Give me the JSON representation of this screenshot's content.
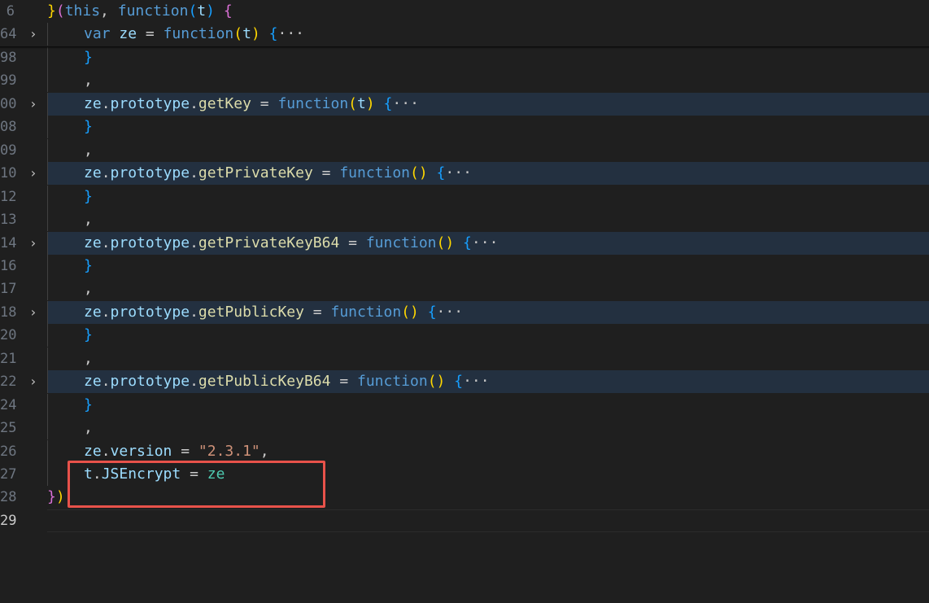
{
  "editor": {
    "theme_colors": {
      "background": "#1f1f1f",
      "collapsed_line_bg": "#233040",
      "keyword": "#569cd6",
      "variable": "#9cdcfe",
      "function_name": "#dcdcaa",
      "string": "#ce9178",
      "class_name": "#4ec9b0",
      "brace_level1": "#ffd700",
      "paren_level2": "#da70d6",
      "brace_level2": "#179fff",
      "highlight_box": "#e8524a"
    },
    "fold_icon": "chevron-right-icon",
    "lines": [
      {
        "number": "6",
        "fold": "",
        "collapsed": false,
        "indent": 0,
        "tokens": [
          {
            "t": "}",
            "c": "brace-gold"
          },
          {
            "t": "(",
            "c": "paren-pink"
          },
          {
            "t": "this",
            "c": "keyword"
          },
          {
            "t": ", ",
            "c": "punc"
          },
          {
            "t": "function",
            "c": "keyword"
          },
          {
            "t": "(",
            "c": "brace-blue"
          },
          {
            "t": "t",
            "c": "var"
          },
          {
            "t": ") ",
            "c": "brace-blue"
          },
          {
            "t": "{",
            "c": "paren-pink"
          }
        ]
      },
      {
        "number": "64",
        "fold": "›",
        "collapsed": false,
        "indent": 1,
        "tokens": [
          {
            "t": "var ",
            "c": "keyword"
          },
          {
            "t": "ze",
            "c": "var"
          },
          {
            "t": " = ",
            "c": "punc"
          },
          {
            "t": "function",
            "c": "keyword"
          },
          {
            "t": "(",
            "c": "brace-gold"
          },
          {
            "t": "t",
            "c": "var"
          },
          {
            "t": ") ",
            "c": "brace-gold"
          },
          {
            "t": "{",
            "c": "brace-blue"
          },
          {
            "t": "···",
            "c": "ellipsis"
          }
        ]
      },
      {
        "number": "98",
        "fold": "",
        "collapsed": false,
        "indent": 1,
        "tokens": [
          {
            "t": "}",
            "c": "brace-blue"
          }
        ]
      },
      {
        "number": "99",
        "fold": "",
        "collapsed": false,
        "indent": 1,
        "tokens": [
          {
            "t": ",",
            "c": "punc"
          }
        ]
      },
      {
        "number": "00",
        "fold": "›",
        "collapsed": true,
        "indent": 1,
        "tokens": [
          {
            "t": "ze",
            "c": "var"
          },
          {
            "t": ".",
            "c": "punc"
          },
          {
            "t": "prototype",
            "c": "var"
          },
          {
            "t": ".",
            "c": "punc"
          },
          {
            "t": "getKey",
            "c": "func"
          },
          {
            "t": " = ",
            "c": "punc"
          },
          {
            "t": "function",
            "c": "keyword"
          },
          {
            "t": "(",
            "c": "brace-gold"
          },
          {
            "t": "t",
            "c": "var"
          },
          {
            "t": ") ",
            "c": "brace-gold"
          },
          {
            "t": "{",
            "c": "brace-blue"
          },
          {
            "t": "···",
            "c": "ellipsis"
          }
        ]
      },
      {
        "number": "08",
        "fold": "",
        "collapsed": false,
        "indent": 1,
        "tokens": [
          {
            "t": "}",
            "c": "brace-blue"
          }
        ]
      },
      {
        "number": "09",
        "fold": "",
        "collapsed": false,
        "indent": 1,
        "tokens": [
          {
            "t": ",",
            "c": "punc"
          }
        ]
      },
      {
        "number": "10",
        "fold": "›",
        "collapsed": true,
        "indent": 1,
        "tokens": [
          {
            "t": "ze",
            "c": "var"
          },
          {
            "t": ".",
            "c": "punc"
          },
          {
            "t": "prototype",
            "c": "var"
          },
          {
            "t": ".",
            "c": "punc"
          },
          {
            "t": "getPrivateKey",
            "c": "func"
          },
          {
            "t": " = ",
            "c": "punc"
          },
          {
            "t": "function",
            "c": "keyword"
          },
          {
            "t": "() ",
            "c": "brace-gold"
          },
          {
            "t": "{",
            "c": "brace-blue"
          },
          {
            "t": "···",
            "c": "ellipsis"
          }
        ]
      },
      {
        "number": "12",
        "fold": "",
        "collapsed": false,
        "indent": 1,
        "tokens": [
          {
            "t": "}",
            "c": "brace-blue"
          }
        ]
      },
      {
        "number": "13",
        "fold": "",
        "collapsed": false,
        "indent": 1,
        "tokens": [
          {
            "t": ",",
            "c": "punc"
          }
        ]
      },
      {
        "number": "14",
        "fold": "›",
        "collapsed": true,
        "indent": 1,
        "tokens": [
          {
            "t": "ze",
            "c": "var"
          },
          {
            "t": ".",
            "c": "punc"
          },
          {
            "t": "prototype",
            "c": "var"
          },
          {
            "t": ".",
            "c": "punc"
          },
          {
            "t": "getPrivateKeyB64",
            "c": "func"
          },
          {
            "t": " = ",
            "c": "punc"
          },
          {
            "t": "function",
            "c": "keyword"
          },
          {
            "t": "() ",
            "c": "brace-gold"
          },
          {
            "t": "{",
            "c": "brace-blue"
          },
          {
            "t": "···",
            "c": "ellipsis"
          }
        ]
      },
      {
        "number": "16",
        "fold": "",
        "collapsed": false,
        "indent": 1,
        "tokens": [
          {
            "t": "}",
            "c": "brace-blue"
          }
        ]
      },
      {
        "number": "17",
        "fold": "",
        "collapsed": false,
        "indent": 1,
        "tokens": [
          {
            "t": ",",
            "c": "punc"
          }
        ]
      },
      {
        "number": "18",
        "fold": "›",
        "collapsed": true,
        "indent": 1,
        "tokens": [
          {
            "t": "ze",
            "c": "var"
          },
          {
            "t": ".",
            "c": "punc"
          },
          {
            "t": "prototype",
            "c": "var"
          },
          {
            "t": ".",
            "c": "punc"
          },
          {
            "t": "getPublicKey",
            "c": "func"
          },
          {
            "t": " = ",
            "c": "punc"
          },
          {
            "t": "function",
            "c": "keyword"
          },
          {
            "t": "() ",
            "c": "brace-gold"
          },
          {
            "t": "{",
            "c": "brace-blue"
          },
          {
            "t": "···",
            "c": "ellipsis"
          }
        ]
      },
      {
        "number": "20",
        "fold": "",
        "collapsed": false,
        "indent": 1,
        "tokens": [
          {
            "t": "}",
            "c": "brace-blue"
          }
        ]
      },
      {
        "number": "21",
        "fold": "",
        "collapsed": false,
        "indent": 1,
        "tokens": [
          {
            "t": ",",
            "c": "punc"
          }
        ]
      },
      {
        "number": "22",
        "fold": "›",
        "collapsed": true,
        "indent": 1,
        "tokens": [
          {
            "t": "ze",
            "c": "var"
          },
          {
            "t": ".",
            "c": "punc"
          },
          {
            "t": "prototype",
            "c": "var"
          },
          {
            "t": ".",
            "c": "punc"
          },
          {
            "t": "getPublicKeyB64",
            "c": "func"
          },
          {
            "t": " = ",
            "c": "punc"
          },
          {
            "t": "function",
            "c": "keyword"
          },
          {
            "t": "() ",
            "c": "brace-gold"
          },
          {
            "t": "{",
            "c": "brace-blue"
          },
          {
            "t": "···",
            "c": "ellipsis"
          }
        ]
      },
      {
        "number": "24",
        "fold": "",
        "collapsed": false,
        "indent": 1,
        "tokens": [
          {
            "t": "}",
            "c": "brace-blue"
          }
        ]
      },
      {
        "number": "25",
        "fold": "",
        "collapsed": false,
        "indent": 1,
        "tokens": [
          {
            "t": ",",
            "c": "punc"
          }
        ]
      },
      {
        "number": "26",
        "fold": "",
        "collapsed": false,
        "indent": 1,
        "tokens": [
          {
            "t": "ze",
            "c": "var"
          },
          {
            "t": ".",
            "c": "punc"
          },
          {
            "t": "version",
            "c": "var"
          },
          {
            "t": " = ",
            "c": "punc"
          },
          {
            "t": "\"2.3.1\"",
            "c": "string"
          },
          {
            "t": ",",
            "c": "punc"
          }
        ]
      },
      {
        "number": "27",
        "fold": "",
        "collapsed": false,
        "indent": 1,
        "tokens": [
          {
            "t": "t",
            "c": "var"
          },
          {
            "t": ".",
            "c": "punc"
          },
          {
            "t": "JSEncrypt",
            "c": "var"
          },
          {
            "t": " = ",
            "c": "punc"
          },
          {
            "t": "ze",
            "c": "class"
          }
        ]
      },
      {
        "number": "28",
        "fold": "",
        "collapsed": false,
        "indent": 0,
        "tokens": [
          {
            "t": "}",
            "c": "paren-pink"
          },
          {
            "t": ")",
            "c": "brace-gold"
          }
        ]
      },
      {
        "number": "29",
        "fold": "",
        "collapsed": false,
        "current": true,
        "indent": 0,
        "tokens": []
      }
    ]
  }
}
